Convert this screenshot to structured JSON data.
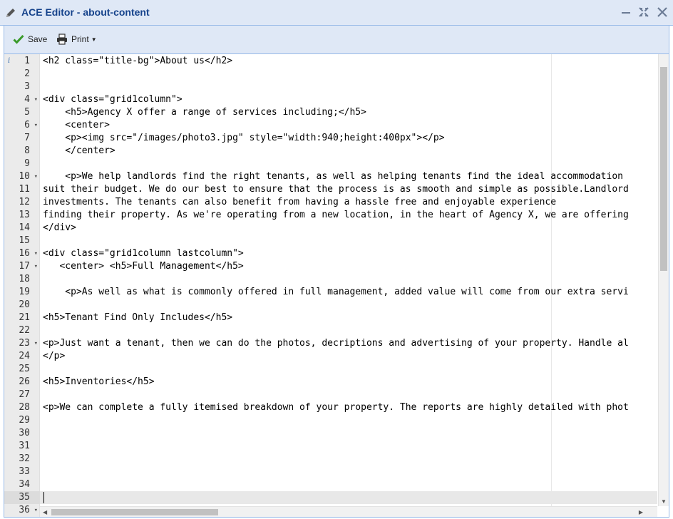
{
  "window": {
    "title": "ACE Editor - about-content",
    "icon": "pencil-icon",
    "controls": [
      "minimize-icon",
      "maximize-icon",
      "close-icon"
    ]
  },
  "toolbar": {
    "save_label": "Save",
    "print_label": "Print",
    "save_icon": "checkmark-icon",
    "print_icon": "printer-icon"
  },
  "editor": {
    "active_line": 35,
    "lines": [
      {
        "n": "1",
        "fold": false,
        "text": "<h2 class=\"title-bg\">About us</h2>"
      },
      {
        "n": "2",
        "fold": false,
        "text": ""
      },
      {
        "n": "3",
        "fold": false,
        "text": ""
      },
      {
        "n": "4",
        "fold": true,
        "text": "<div class=\"grid1column\">"
      },
      {
        "n": "5",
        "fold": false,
        "text": "    <h5>Agency X offer a range of services including;</h5>"
      },
      {
        "n": "6",
        "fold": true,
        "text": "    <center>"
      },
      {
        "n": "7",
        "fold": false,
        "text": "    <p><img src=\"/images/photo3.jpg\" style=\"width:940;height:400px\"></p>"
      },
      {
        "n": "8",
        "fold": false,
        "text": "    </center>"
      },
      {
        "n": "9",
        "fold": false,
        "text": ""
      },
      {
        "n": "10",
        "fold": true,
        "text": "    <p>We help landlords find the right tenants, as well as helping tenants find the ideal accommodation"
      },
      {
        "n": "11",
        "fold": false,
        "text": "suit their budget. We do our best to ensure that the process is as smooth and simple as possible.Landlord"
      },
      {
        "n": "12",
        "fold": false,
        "text": "investments. The tenants can also benefit from having a hassle free and enjoyable experience"
      },
      {
        "n": "13",
        "fold": false,
        "text": "finding their property. As we're operating from a new location, in the heart of Agency X, we are offering"
      },
      {
        "n": "14",
        "fold": false,
        "text": "</div>"
      },
      {
        "n": "15",
        "fold": false,
        "text": ""
      },
      {
        "n": "16",
        "fold": true,
        "text": "<div class=\"grid1column lastcolumn\">"
      },
      {
        "n": "17",
        "fold": true,
        "text": "   <center> <h5>Full Management</h5>"
      },
      {
        "n": "18",
        "fold": false,
        "text": ""
      },
      {
        "n": "19",
        "fold": false,
        "text": "    <p>As well as what is commonly offered in full management, added value will come from our extra servi"
      },
      {
        "n": "20",
        "fold": false,
        "text": ""
      },
      {
        "n": "21",
        "fold": false,
        "text": "<h5>Tenant Find Only Includes</h5>"
      },
      {
        "n": "22",
        "fold": false,
        "text": ""
      },
      {
        "n": "23",
        "fold": true,
        "text": "<p>Just want a tenant, then we can do the photos, decriptions and advertising of your property. Handle al"
      },
      {
        "n": "24",
        "fold": false,
        "text": "</p>"
      },
      {
        "n": "25",
        "fold": false,
        "text": ""
      },
      {
        "n": "26",
        "fold": false,
        "text": "<h5>Inventories</h5>"
      },
      {
        "n": "27",
        "fold": false,
        "text": ""
      },
      {
        "n": "28",
        "fold": false,
        "text": "<p>We can complete a fully itemised breakdown of your property. The reports are highly detailed with phot"
      },
      {
        "n": "29",
        "fold": false,
        "text": ""
      },
      {
        "n": "30",
        "fold": false,
        "text": ""
      },
      {
        "n": "31",
        "fold": false,
        "text": ""
      },
      {
        "n": "32",
        "fold": false,
        "text": ""
      },
      {
        "n": "33",
        "fold": false,
        "text": ""
      },
      {
        "n": "34",
        "fold": false,
        "text": ""
      },
      {
        "n": "35",
        "fold": false,
        "text": ""
      },
      {
        "n": "36",
        "fold": true,
        "text": ""
      }
    ]
  },
  "colors": {
    "titlebar_bg": "#dfe8f6",
    "title_text": "#15428b",
    "border": "#99bbe8",
    "save_check": "#3a9a2a"
  }
}
